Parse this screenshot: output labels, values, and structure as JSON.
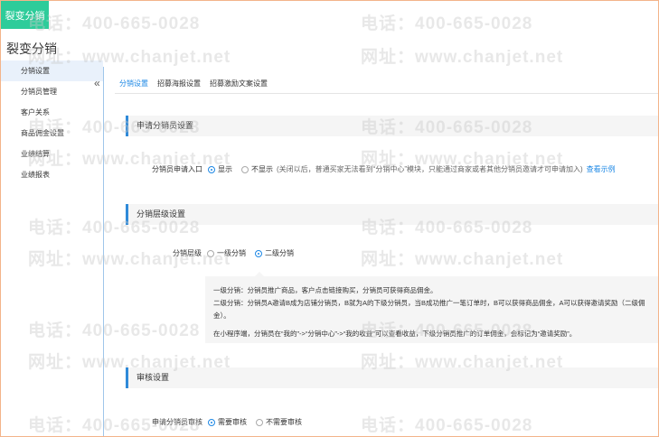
{
  "badge": "裂变分销",
  "app_title": "裂变分销",
  "sidebar": {
    "items": [
      {
        "label": "分销设置"
      },
      {
        "label": "分销员管理"
      },
      {
        "label": "客户关系"
      },
      {
        "label": "商品佣金设置"
      },
      {
        "label": "业绩结算"
      },
      {
        "label": "业绩报表"
      }
    ],
    "collapse_symbol": "«"
  },
  "tabs": [
    {
      "label": "分销设置"
    },
    {
      "label": "招募海报设置"
    },
    {
      "label": "招募激励文案设置"
    }
  ],
  "apply_section": {
    "title": "申请分销员设置",
    "field_label": "分销员申请入口",
    "option_show": "显示",
    "option_hide": "不显示",
    "hint": "(关闭以后，普通买家无法看到“分销中心”模块，只能通过商家或者其他分销员邀请才可申请加入)",
    "link": "查看示例"
  },
  "level_section": {
    "title": "分销层级设置",
    "field_label": "分销层级",
    "option_one": "一级分销",
    "option_two": "二级分销",
    "info_line1": "一级分销：分销员推广商品，客户点击链接购买，分销员可获得商品佣金。",
    "info_line2": "二级分销：分销员A邀请B成为店铺分销员，B就为A的下级分销员，当B成功推广一笔订单时，B可以获得商品佣金，A可以获得邀请奖励（二级佣金）。",
    "info_line3": "在小程序端，分销员在“我的”->“分销中心”->“我的收益”可以查看收益，下级分销员推广的订单佣金，会标记为“邀请奖励”。"
  },
  "audit_section": {
    "title": "审核设置",
    "field_label": "申请分销员审核",
    "option_need": "需要审核",
    "option_no": "不需要审核"
  },
  "watermark": {
    "phone": "电话：400-665-0028",
    "site": "网址：www.chanjet.net"
  },
  "colors": {
    "badge": "#2ecc9a",
    "accent": "#1e88e5",
    "frame": "#f3b48a"
  }
}
